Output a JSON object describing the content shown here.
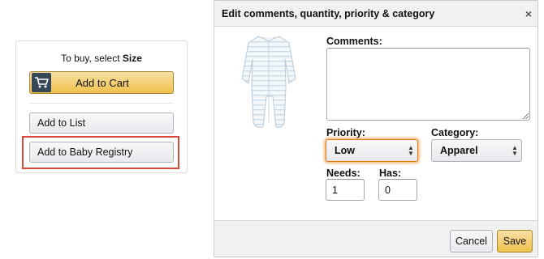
{
  "buy_box": {
    "hint_prefix": "To buy, select ",
    "hint_bold": "Size",
    "add_to_cart_label": "Add to Cart",
    "add_to_list_label": "Add to List",
    "add_to_registry_label": "Add to Baby Registry"
  },
  "modal": {
    "title": "Edit comments, quantity, priority & category",
    "close_symbol": "×",
    "comments_label": "Comments:",
    "comments_value": "",
    "priority_label": "Priority:",
    "priority_value": "Low",
    "category_label": "Category:",
    "category_value": "Apparel",
    "needs_label": "Needs:",
    "needs_value": "1",
    "has_label": "Has:",
    "has_value": "0",
    "cancel_label": "Cancel",
    "save_label": "Save"
  },
  "colors": {
    "primary_button": "#f0c14b",
    "highlight_border": "#d9493b",
    "focus_ring": "#e77600"
  }
}
